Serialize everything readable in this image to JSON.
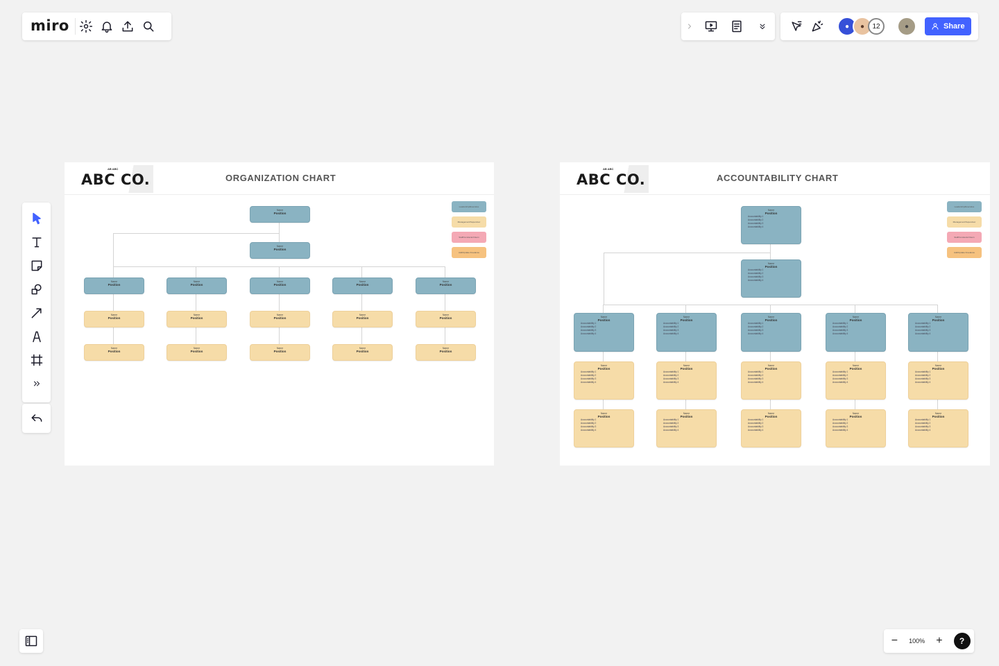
{
  "app": {
    "logo": "miro"
  },
  "toolbar_left_icons": [
    "settings-icon",
    "bell-icon",
    "upload-icon",
    "search-icon"
  ],
  "collab": {
    "avatar_count": "12",
    "share_label": "Share"
  },
  "zoom": {
    "level": "100%",
    "minus": "−",
    "plus": "+",
    "help": "?"
  },
  "frames": [
    {
      "brand_small": "AB ABC",
      "brand": "ABC CO.",
      "title": "ORGANIZATION CHART",
      "legend": [
        {
          "label": "Leadership/Executive",
          "color": "#8ab3c2"
        },
        {
          "label": "Management/Supervisor",
          "color": "#f6dca8"
        },
        {
          "label": "Staff/Contractor/Intern",
          "color": "#f4a9b5"
        },
        {
          "label": "Add/Update Freelance",
          "color": "#f6c27f"
        }
      ],
      "name_label": "Name",
      "position_label": "Position"
    },
    {
      "brand_small": "AB ABC",
      "brand": "ABC CO.",
      "title": "ACCOUNTABILITY CHART",
      "legend": [
        {
          "label": "Leadership/Executive",
          "color": "#8ab3c2"
        },
        {
          "label": "Management/Supervisor",
          "color": "#f6dca8"
        },
        {
          "label": "Staff/Contractor/Intern",
          "color": "#f4a9b5"
        },
        {
          "label": "Add/Update Freelance",
          "color": "#f6c27f"
        }
      ],
      "name_label": "Name",
      "position_label": "Position",
      "accountabilities": [
        "Accountability 1",
        "Accountability 2",
        "Accountability 3",
        "Accountability 4"
      ]
    }
  ],
  "colors": {
    "accent": "#4262ff",
    "blue_box": "#8ab3c2",
    "yellow_box": "#f6dca8",
    "canvas": "#f2f2f2"
  }
}
